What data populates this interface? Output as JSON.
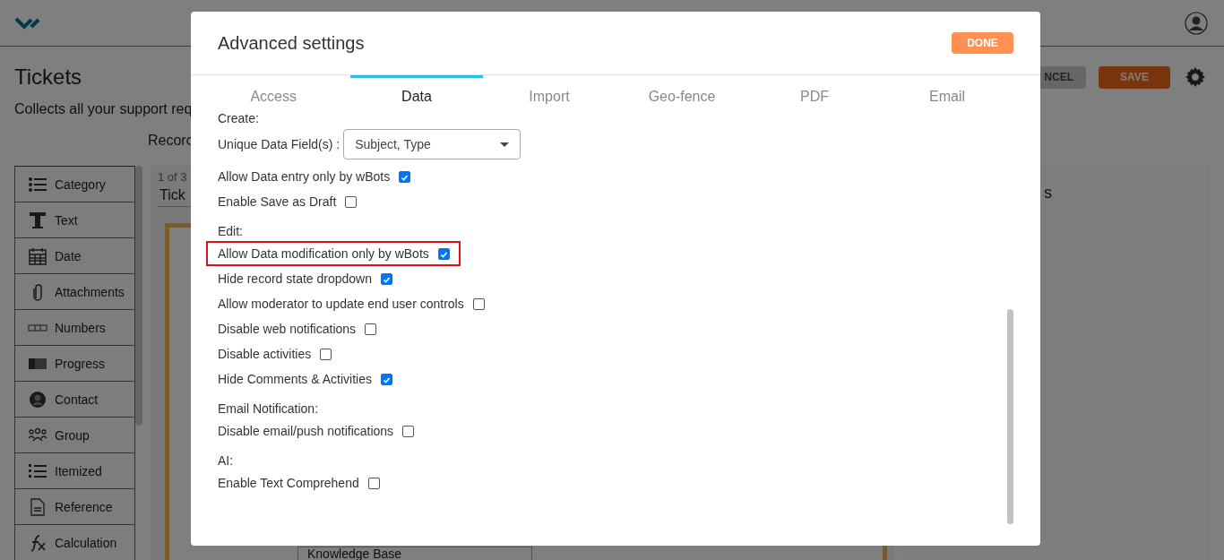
{
  "page": {
    "title": "Tickets",
    "description": "Collects all your support req",
    "record_label": "Recorc",
    "cancel_button": "NCEL",
    "save_button": "SAVE",
    "sidebar": {
      "items": [
        {
          "label": "Category"
        },
        {
          "label": "Text"
        },
        {
          "label": "Date"
        },
        {
          "label": "Attachments"
        },
        {
          "label": "Numbers"
        },
        {
          "label": "Progress"
        },
        {
          "label": "Contact"
        },
        {
          "label": "Group"
        },
        {
          "label": "Itemized"
        },
        {
          "label": "Reference"
        },
        {
          "label": "Calculation"
        }
      ]
    },
    "canvas": {
      "pager": "1 of 3",
      "tab": "Tick",
      "select_value": "Knowledge Base"
    },
    "right_panel": {
      "title": "s"
    }
  },
  "modal": {
    "title": "Advanced settings",
    "done_button": "DONE",
    "tabs": [
      {
        "label": "Access",
        "selected": false
      },
      {
        "label": "Data",
        "selected": true
      },
      {
        "label": "Import",
        "selected": false
      },
      {
        "label": "Geo-fence",
        "selected": false
      },
      {
        "label": "PDF",
        "selected": false
      },
      {
        "label": "Email",
        "selected": false
      }
    ],
    "sections": [
      {
        "heading": "Create:",
        "items": [
          {
            "kind": "select",
            "label": "Unique Data Field(s) :",
            "value": "Subject, Type"
          },
          {
            "kind": "checkbox",
            "label": "Allow Data entry only by wBots",
            "checked": true,
            "highlighted": false
          },
          {
            "kind": "checkbox",
            "label": "Enable Save as Draft",
            "checked": false,
            "highlighted": false
          }
        ]
      },
      {
        "heading": "Edit:",
        "items": [
          {
            "kind": "checkbox",
            "label": "Allow Data modification only by wBots",
            "checked": true,
            "highlighted": true
          },
          {
            "kind": "checkbox",
            "label": "Hide record state dropdown",
            "checked": true,
            "highlighted": false
          },
          {
            "kind": "checkbox",
            "label": "Allow moderator to update end user controls",
            "checked": false,
            "highlighted": false
          },
          {
            "kind": "checkbox",
            "label": "Disable web notifications",
            "checked": false,
            "highlighted": false
          },
          {
            "kind": "checkbox",
            "label": "Disable activities",
            "checked": false,
            "highlighted": false
          },
          {
            "kind": "checkbox",
            "label": "Hide Comments & Activities",
            "checked": true,
            "highlighted": false
          }
        ]
      },
      {
        "heading": "Email Notification:",
        "items": [
          {
            "kind": "checkbox",
            "label": "Disable email/push notifications",
            "checked": false,
            "highlighted": false
          }
        ]
      },
      {
        "heading": "AI:",
        "items": [
          {
            "kind": "checkbox",
            "label": "Enable Text Comprehend",
            "checked": false,
            "highlighted": false
          }
        ]
      }
    ]
  }
}
